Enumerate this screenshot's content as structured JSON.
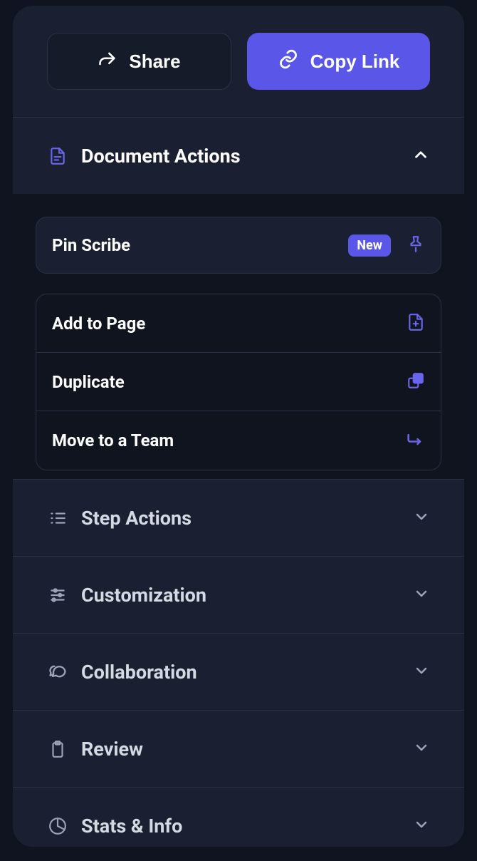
{
  "top": {
    "share_label": "Share",
    "copy_label": "Copy Link"
  },
  "sections": {
    "document_actions": {
      "title": "Document Actions",
      "pin": {
        "label": "Pin Scribe",
        "badge": "New"
      },
      "items": [
        {
          "label": "Add to Page"
        },
        {
          "label": "Duplicate"
        },
        {
          "label": "Move to a Team"
        }
      ]
    },
    "step_actions": {
      "title": "Step Actions"
    },
    "customization": {
      "title": "Customization"
    },
    "collaboration": {
      "title": "Collaboration"
    },
    "review": {
      "title": "Review"
    },
    "stats_info": {
      "title": "Stats & Info"
    }
  }
}
